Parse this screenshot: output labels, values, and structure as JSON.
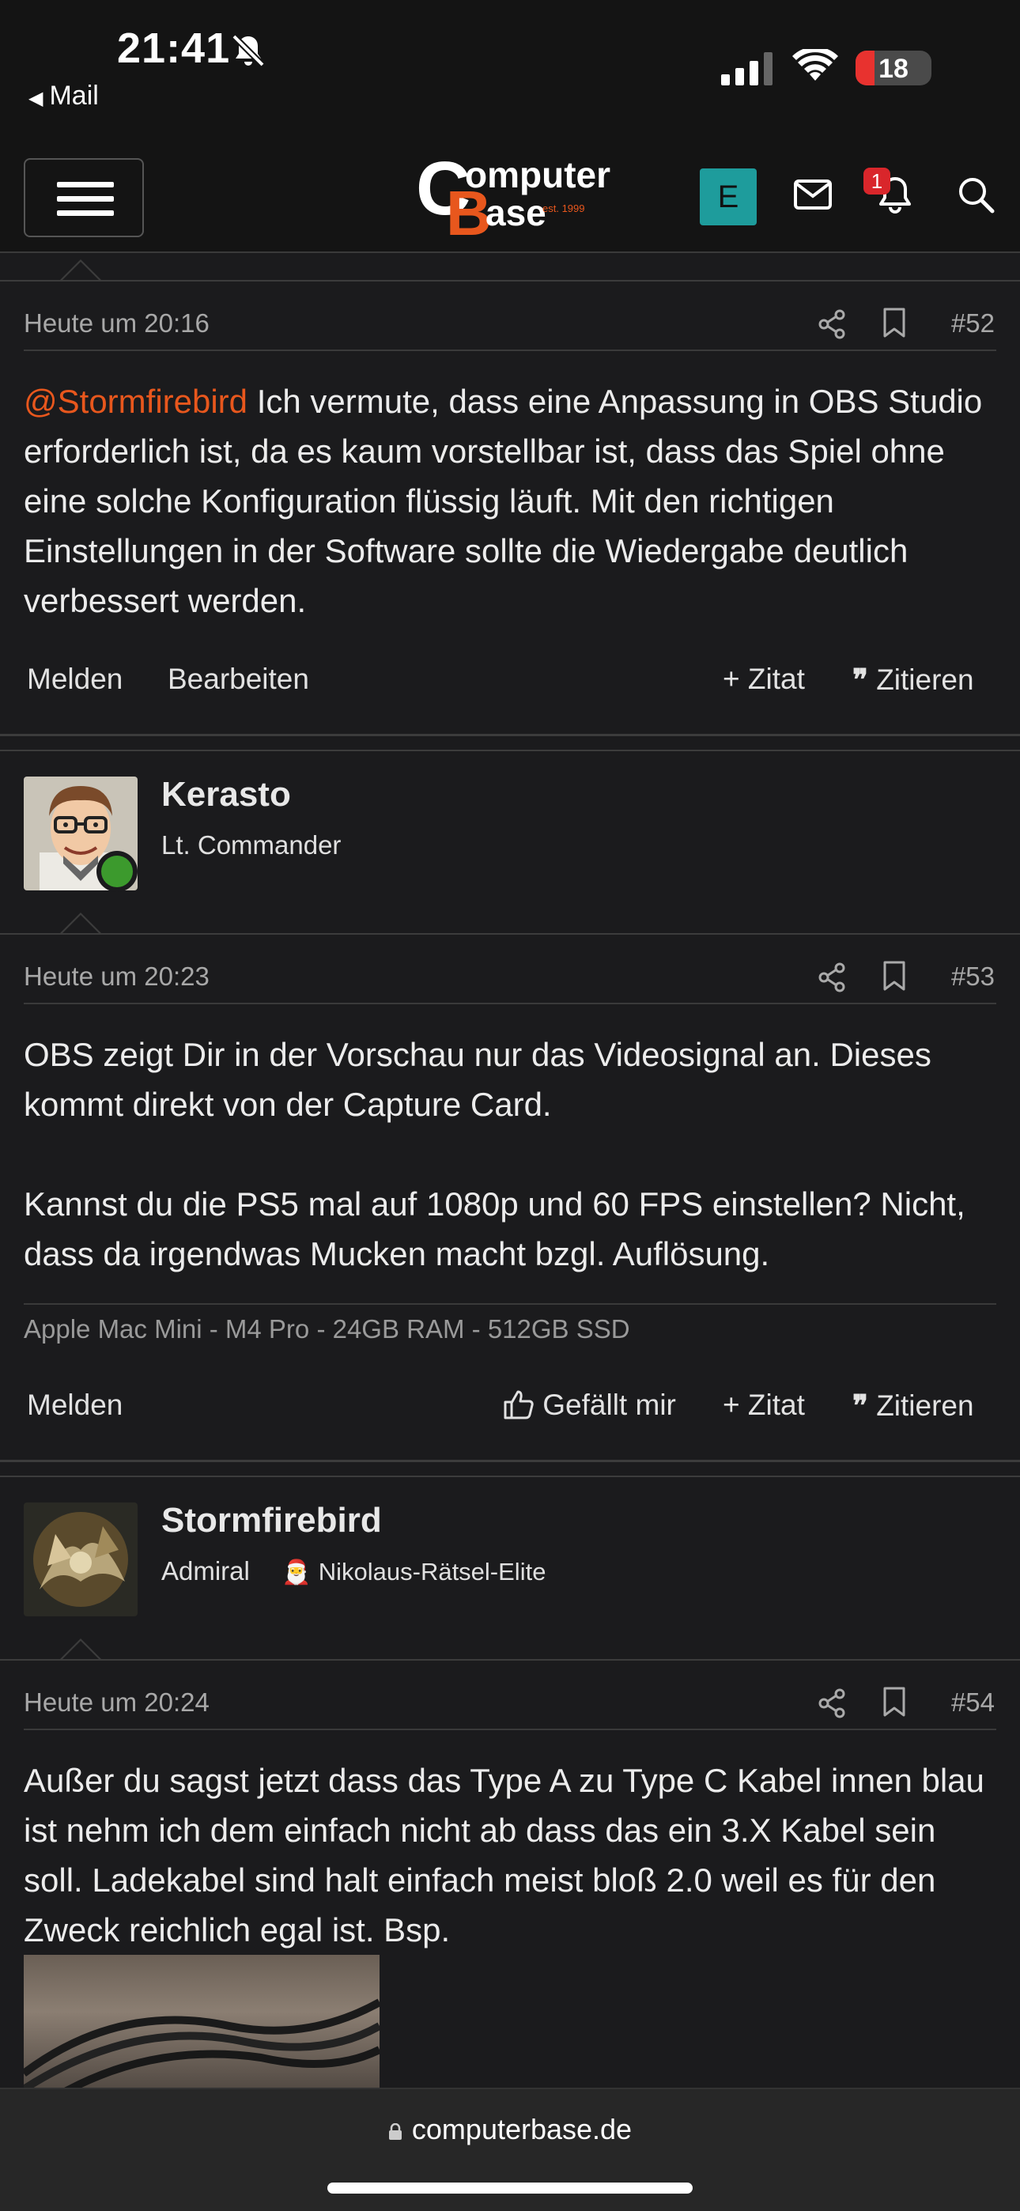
{
  "status_bar": {
    "time": "21:41",
    "back_app": "Mail",
    "battery": "18"
  },
  "header": {
    "logo_text_1": "omputer",
    "logo_text_2": "ase",
    "logo_c": "C",
    "logo_b": "B",
    "logo_est": "est. 1999",
    "user_initial": "E",
    "notification_count": "1",
    "icons": [
      "menu-icon",
      "mail-icon",
      "bell-icon",
      "search-icon"
    ]
  },
  "posts": [
    {
      "date": "Heute um 20:16",
      "number": "#52",
      "mention": "@Stormfirebird",
      "text": " Ich vermute, dass eine Anpassung in OBS Studio erforderlich ist, da es kaum vorstellbar ist, dass das Spiel ohne eine solche Konfiguration flüssig läuft. Mit den richtigen Einstellungen in der Software sollte die Wiedergabe deutlich verbessert werden.",
      "actions": {
        "report": "Melden",
        "edit": "Bearbeiten",
        "quote_add": "Zitat",
        "quote": "Zitieren"
      }
    },
    {
      "author": "Kerasto",
      "rank": "Lt. Commander",
      "date": "Heute um 20:23",
      "number": "#53",
      "paragraphs": [
        "OBS zeigt Dir in der Vorschau nur das Videosignal an. Dieses kommt direkt von der Capture Card.",
        "Kannst du die PS5 mal auf 1080p und 60 FPS einstellen? Nicht, dass da irgendwas Mucken macht bzgl. Auflösung."
      ],
      "signature": "Apple Mac Mini - M4 Pro - 24GB RAM - 512GB SSD",
      "actions": {
        "report": "Melden",
        "like": "Gefällt mir",
        "quote_add": "Zitat",
        "quote": "Zitieren"
      }
    },
    {
      "author": "Stormfirebird",
      "rank": "Admiral",
      "badge": "Nikolaus-Rätsel-Elite",
      "date": "Heute um 20:24",
      "number": "#54",
      "text": "Außer du sagst jetzt dass das Type A zu Type C Kabel innen blau ist nehm ich dem einfach nicht ab dass das ein 3.X Kabel sein soll. Ladekabel sind halt einfach meist bloß 2.0 weil es für den Zweck reichlich egal ist. Bsp."
    }
  ],
  "browser": {
    "url": "computerbase.de"
  }
}
